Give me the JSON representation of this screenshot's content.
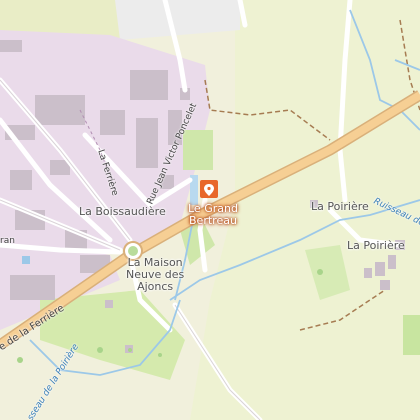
{
  "map": {
    "poi": {
      "name_line1": "Le Grand",
      "name_line2": "Bertreau",
      "icon": "location-pin-icon",
      "color": "#e8672a"
    },
    "places": {
      "la_boissaudiere": "La Boissaudière",
      "la_poiriere_1": "La Poirière",
      "la_poiriere_2": "La Poirière",
      "la_maison_line1": "La Maison",
      "la_maison_line2": "Neuve des",
      "la_maison_line3": "Ajoncs"
    },
    "roads": {
      "rue_jean_victor_poncelet": "Rue Jean Victor Poncelet",
      "ferriere_vertical": "La Ferrière",
      "route_de_la_ferriere": "e de la Ferrière",
      "partial_ran": "ran"
    },
    "waterways": {
      "ruisseau_east": "Ruisseau de",
      "ruisseau_south": "sseau de la Poirière"
    },
    "colors": {
      "background": "#f2efe3",
      "urban": "#e8d6e6",
      "field": "#dfeab0",
      "meadow": "#cfe6a8",
      "main_road": "#f5c98c",
      "water": "#9cc8e8"
    }
  }
}
